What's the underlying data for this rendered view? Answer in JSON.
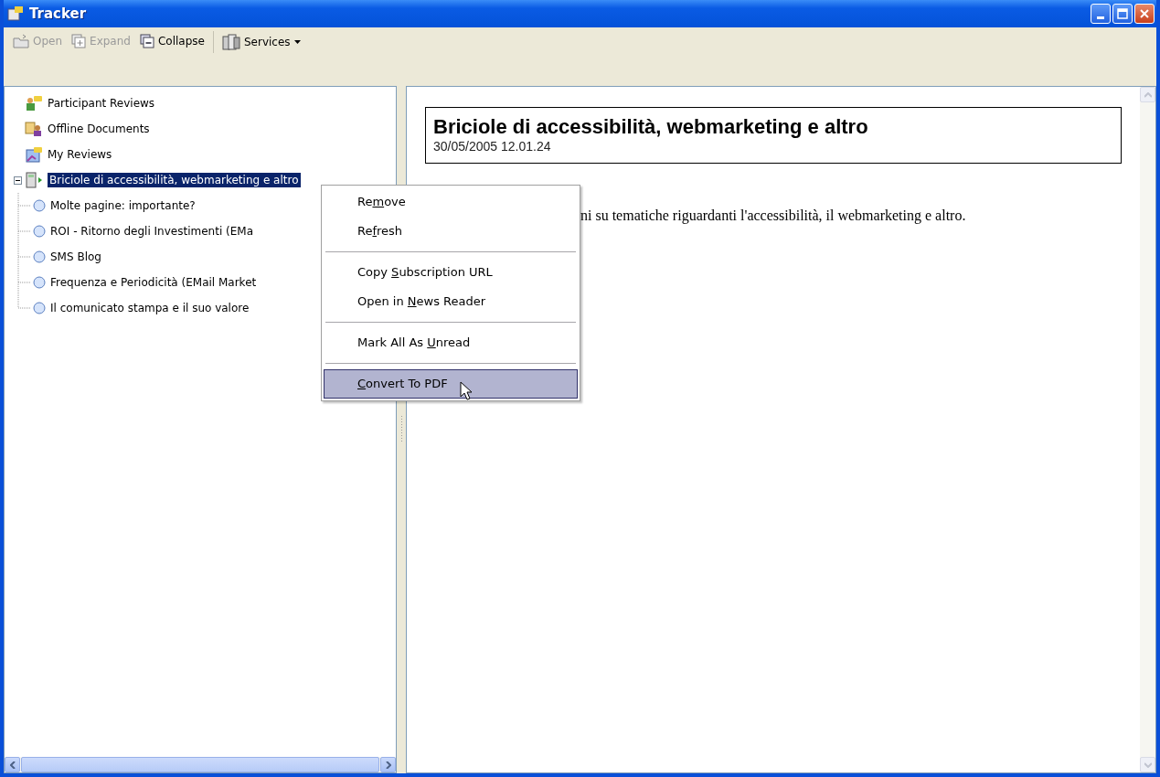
{
  "window": {
    "title": "Tracker"
  },
  "toolbar": {
    "buttons": [
      {
        "label": "Open",
        "kind": "open",
        "disabled": true
      },
      {
        "label": "Expand",
        "kind": "expand",
        "disabled": true
      },
      {
        "label": "Collapse",
        "kind": "collapse",
        "disabled": false
      },
      {
        "label": "Services",
        "kind": "services",
        "disabled": false,
        "dropdown": true
      }
    ]
  },
  "tree": {
    "items": [
      {
        "label": "Participant Reviews",
        "kind": "participant",
        "selected": false
      },
      {
        "label": "Offline Documents",
        "kind": "offline",
        "selected": false
      },
      {
        "label": "My Reviews",
        "kind": "myreviews",
        "selected": false
      },
      {
        "label": "Briciole di accessibilità, webmarketing e altro",
        "kind": "feed",
        "selected": true,
        "expanded": true,
        "children": [
          {
            "label": "Molte pagine: importante?",
            "selected": false
          },
          {
            "label": "ROI - Ritorno degli Investimenti (EMa",
            "selected": false
          },
          {
            "label": "SMS Blog",
            "selected": false
          },
          {
            "label": "Frequenza e Periodicità (EMail Market",
            "selected": false
          },
          {
            "label": "Il comunicato stampa e il suo valore",
            "selected": false
          }
        ]
      }
    ]
  },
  "context_menu": {
    "groups": [
      [
        {
          "pre": "Re",
          "key": "m",
          "post": "ove",
          "selected": false
        },
        {
          "pre": "Re",
          "key": "f",
          "post": "resh",
          "selected": false
        }
      ],
      [
        {
          "pre": "Copy ",
          "key": "S",
          "post": "ubscription URL",
          "selected": false
        },
        {
          "pre": "Open in ",
          "key": "N",
          "post": "ews Reader",
          "selected": false
        }
      ],
      [
        {
          "pre": "Mark All As ",
          "key": "U",
          "post": "nread",
          "selected": false
        }
      ],
      [
        {
          "key": "C",
          "post": "onvert To PDF",
          "selected": true
        }
      ]
    ]
  },
  "document": {
    "title": "Briciole di accessibilità, webmarketing e altro",
    "date": "30/05/2005 12.01.24",
    "body": "ni su tematiche riguardanti l'accessibilità, il webmarketing e altro."
  }
}
